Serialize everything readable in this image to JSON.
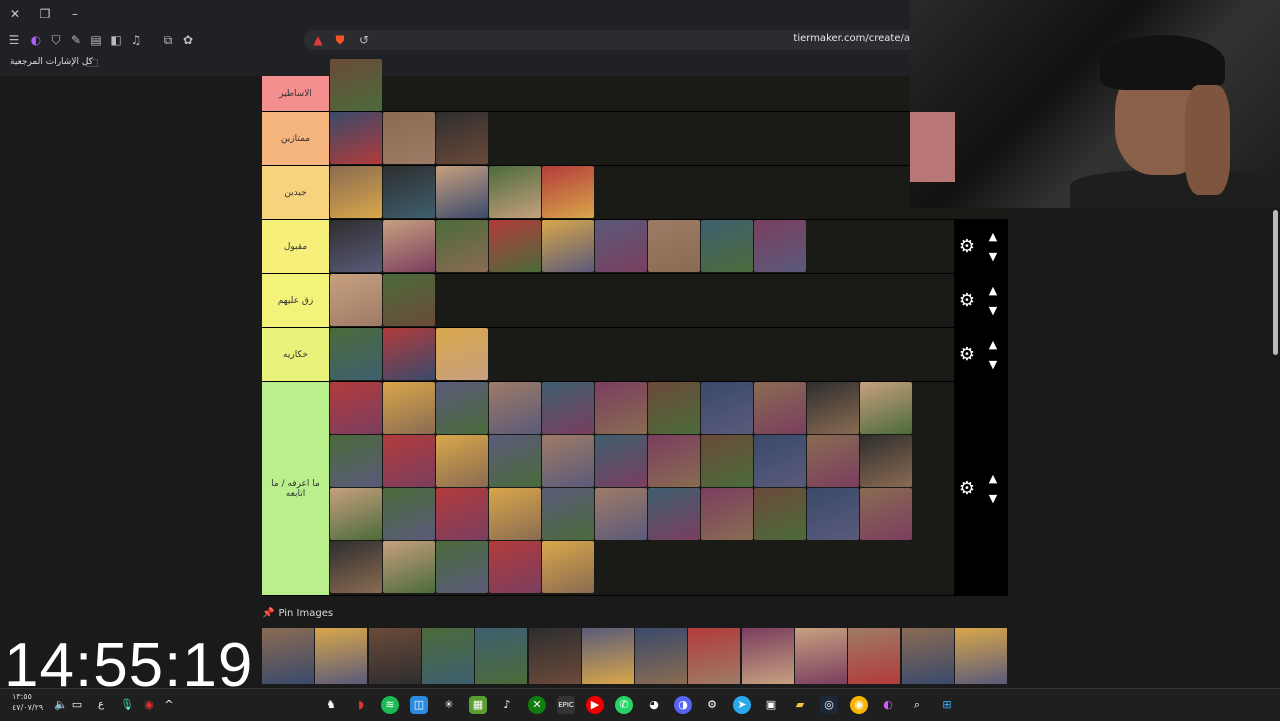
{
  "browser": {
    "url": "tiermaker.com/create/a",
    "bookmarks_label": "كل الإشارات المرجعية",
    "window_controls": [
      "close-icon",
      "restore-icon",
      "minimize-icon"
    ]
  },
  "tiers": [
    {
      "label": "الاساطير",
      "color": "#f48f8f",
      "count": 1
    },
    {
      "label": "ممتازين",
      "color": "#f6b57e",
      "count": 3
    },
    {
      "label": "جيدين",
      "color": "#f7d37e",
      "count": 5
    },
    {
      "label": "مقبول",
      "color": "#f6f07a",
      "count": 9
    },
    {
      "label": "زق عليهم",
      "color": "#f3f37a",
      "count": 2
    },
    {
      "label": "خكاريه",
      "color": "#e9f27a",
      "count": 3
    },
    {
      "label": "ما اعرفه / ما اتابعه",
      "color": "#b9f08b",
      "count": 38
    }
  ],
  "pin_images_label": "Pin Images",
  "pool_count": 14,
  "clock": "14:55:19",
  "tray": {
    "time": "١٣:٥٥",
    "date": "٤٧/٠٧/٢٩",
    "lang": "ع"
  },
  "colors": {
    "tile_palette": [
      "#6b4a3a",
      "#3a4a6b",
      "#8a6b52",
      "#2e2e2e",
      "#c7a07f",
      "#4b6b3a",
      "#b23b3b",
      "#d9a74a",
      "#5a5a7a",
      "#9e7b66",
      "#3e5f6f",
      "#7a3e5f"
    ]
  }
}
